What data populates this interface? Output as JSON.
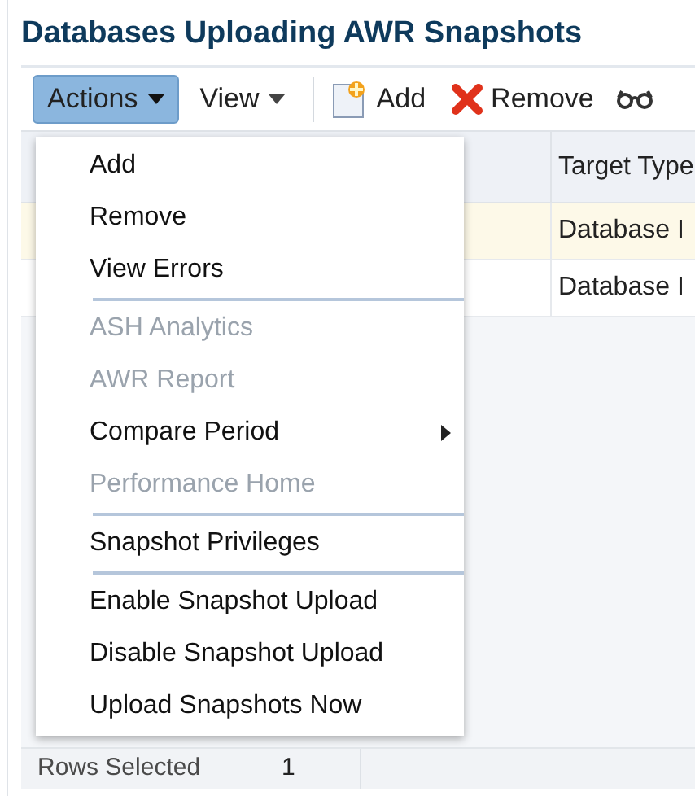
{
  "title": "Databases Uploading AWR Snapshots",
  "toolbar": [
    {
      "label": "Actions",
      "kind": "menu",
      "expanded": true
    },
    {
      "label": "View",
      "kind": "menu",
      "expanded": false
    },
    {
      "label": "Add",
      "kind": "add"
    },
    {
      "label": "Remove",
      "kind": "remove"
    },
    {
      "kind": "glasses"
    }
  ],
  "table": {
    "columns": [
      "Target Type"
    ],
    "rows": [
      {
        "cells": [
          "Database I"
        ],
        "selected": true
      },
      {
        "cells": [
          "Database I"
        ],
        "selected": false
      }
    ]
  },
  "menu": [
    {
      "kind": "item",
      "label": "Add",
      "disabled": false
    },
    {
      "kind": "item",
      "label": "Remove",
      "disabled": false
    },
    {
      "kind": "item",
      "label": "View Errors",
      "disabled": false
    },
    {
      "kind": "separator"
    },
    {
      "kind": "item",
      "label": "ASH Analytics",
      "disabled": true
    },
    {
      "kind": "item",
      "label": "AWR Report",
      "disabled": true
    },
    {
      "kind": "submenu",
      "label": "Compare Period",
      "disabled": false
    },
    {
      "kind": "item",
      "label": "Performance Home",
      "disabled": true
    },
    {
      "kind": "separator"
    },
    {
      "kind": "item",
      "label": "Snapshot Privileges",
      "disabled": false
    },
    {
      "kind": "separator"
    },
    {
      "kind": "item",
      "label": "Enable Snapshot Upload",
      "disabled": false
    },
    {
      "kind": "item",
      "label": "Disable Snapshot Upload",
      "disabled": false
    },
    {
      "kind": "item",
      "label": "Upload Snapshots Now",
      "disabled": false
    }
  ],
  "status": {
    "label": "Rows Selected",
    "value": "1"
  }
}
